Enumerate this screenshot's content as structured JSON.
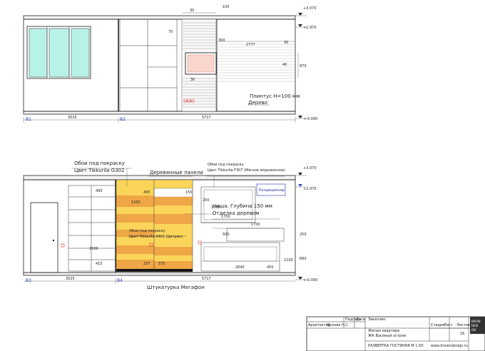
{
  "elev1": {
    "dims_top": [
      "30",
      "100"
    ],
    "dims_small": [
      "300",
      "2777",
      "30",
      "30",
      "40",
      "870",
      "70"
    ],
    "levels": [
      "+3.070",
      "+2.970",
      "+-0.000"
    ],
    "axes": [
      "B1",
      "B2"
    ],
    "dims_bottom": [
      "3025",
      "5717"
    ],
    "note_line1": "Плинтус H=100 мм",
    "note_line2": "Дерево"
  },
  "elev2": {
    "label_wallpaper1_l1": "Обои под покраску",
    "label_wallpaper1_l2": "Цвет Tikkurila G302",
    "label_wood_panels": "Деревянные панели",
    "label_wallpaper2_l1": "Обои под покраску",
    "label_wallpaper2_l2": "Цвет Tikkurila F307 (Мягкое мороженное)",
    "label_ac": "Кондиционер",
    "label_niche_l1": "Ниша. Глубина 150 мм",
    "label_niche_l2": "Отделка деревом",
    "label_wallpaper3_l1": "Обои под покраску",
    "label_wallpaper3_l2": "Цвет Tikkurila X401 (Цитрин)",
    "levels": [
      "+3.070",
      "+2.970",
      "+-0.000"
    ],
    "axes": [
      "B3",
      "B4"
    ],
    "dims_bottom": [
      "3025",
      "5717"
    ],
    "dims_inner": [
      "495",
      "495",
      "150",
      "1250",
      "1500",
      "415",
      "237",
      "575",
      "200",
      "1150",
      "1700",
      "1700",
      "500",
      "2640",
      "450",
      "1100",
      "250",
      "680"
    ],
    "bottom_caption": "Штукатурка Мегафон"
  },
  "stamp": {
    "hdr_podp": "Подпись",
    "hdr_data": "Дата",
    "hdr_zakazchik": "Заказчик:",
    "arch_role": "Архитектор",
    "arch_name": "Орлова Н.С.",
    "object_l1": "Жилая квартира",
    "object_l2": "ЖК Васиный остров",
    "stadia": "Стадия",
    "list": "Лист",
    "listov": "Листов",
    "list_no": "16",
    "sheet_title": "РАЗВЕРТКА ГОСТИНАЯ М 1:50",
    "website": "www.browndesign.ru",
    "logo": "BROWN DESIGN"
  },
  "colors": {
    "yellow": "#fbd55a",
    "orange": "#efa646",
    "window_glass": "#b8f2e6",
    "tv": "#f2a285",
    "accent_blue": "#2a3aa8"
  }
}
